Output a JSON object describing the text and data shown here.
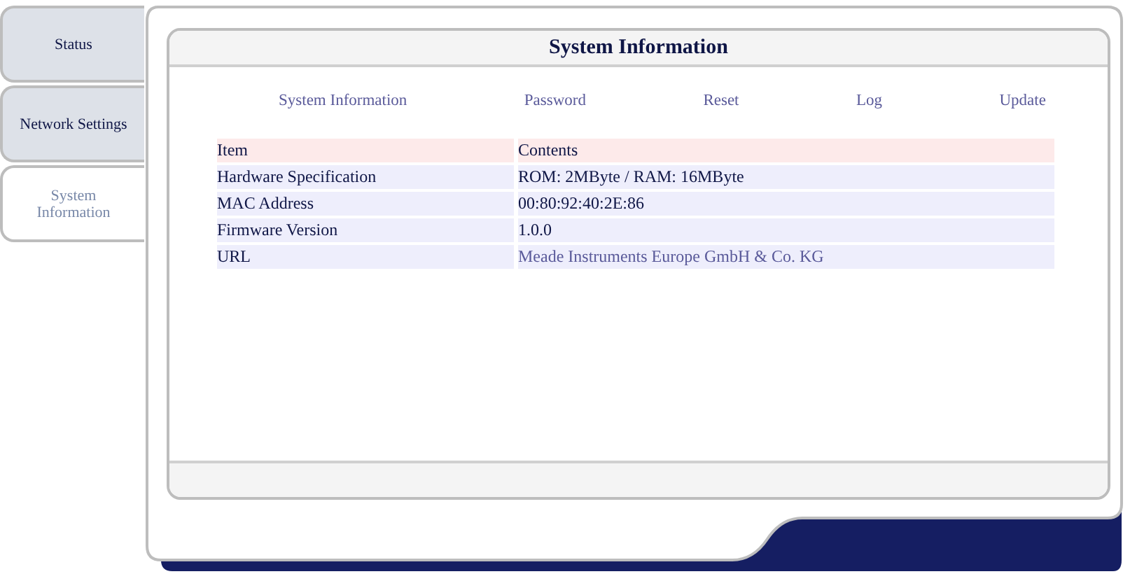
{
  "sidebar": {
    "items": [
      {
        "label": "Status",
        "selected": false
      },
      {
        "label": "Network Settings",
        "selected": false
      },
      {
        "label": "System Information",
        "selected": true
      }
    ]
  },
  "panel": {
    "title": "System Information"
  },
  "nav_links": [
    "System Information",
    "Password",
    "Reset",
    "Log",
    "Update"
  ],
  "table": {
    "columns": [
      "Item",
      "Contents"
    ],
    "rows": [
      {
        "cells": [
          "Hardware Specification",
          "ROM: 2MByte / RAM: 16MByte"
        ],
        "kind": "text"
      },
      {
        "cells": [
          "MAC Address",
          "00:80:92:40:2E:86"
        ],
        "kind": "text"
      },
      {
        "cells": [
          "Firmware Version",
          "1.0.0"
        ],
        "kind": "text"
      },
      {
        "cells": [
          "URL",
          "Meade Instruments Europe GmbH & Co. KG"
        ],
        "kind": "link"
      }
    ]
  }
}
